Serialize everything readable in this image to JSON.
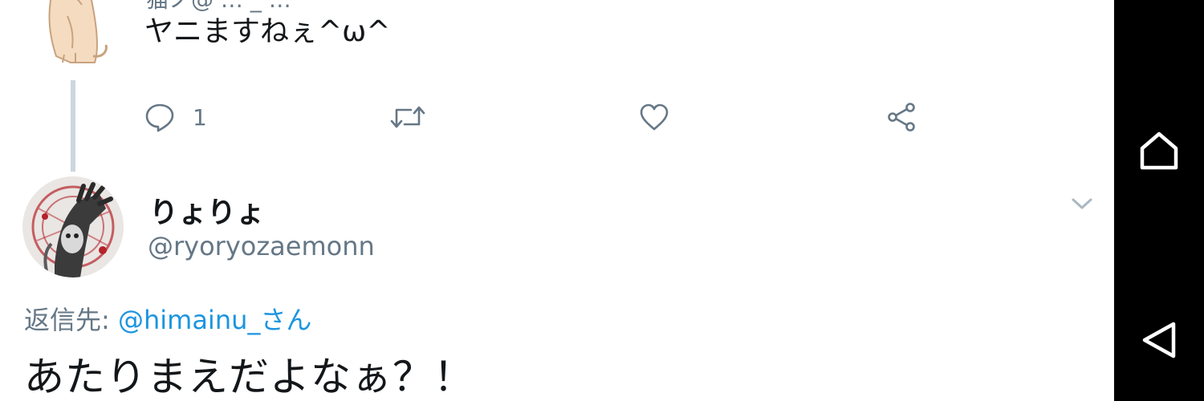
{
  "parent_tweet": {
    "cropped_header": "猫ノ@ … _ …",
    "text": "ヤニますねぇ^ω^",
    "actions": {
      "reply_count": "1"
    }
  },
  "reply_tweet": {
    "display_name": "りょりょ",
    "handle": "@ryoryozaemonn",
    "reply_to_label": "返信先: ",
    "reply_to_user": "@himainu_さん",
    "text": "あたりまえだよなぁ？！"
  },
  "colors": {
    "text_primary": "#14171a",
    "text_secondary": "#657786",
    "link": "#1b95e0",
    "thread_line": "#ccd6dd",
    "navbar": "#000000"
  },
  "icons": {
    "reply": "reply-icon",
    "retweet": "retweet-icon",
    "like": "heart-icon",
    "share": "share-icon",
    "caret": "chevron-down-icon",
    "home": "home-icon",
    "back": "back-icon"
  }
}
